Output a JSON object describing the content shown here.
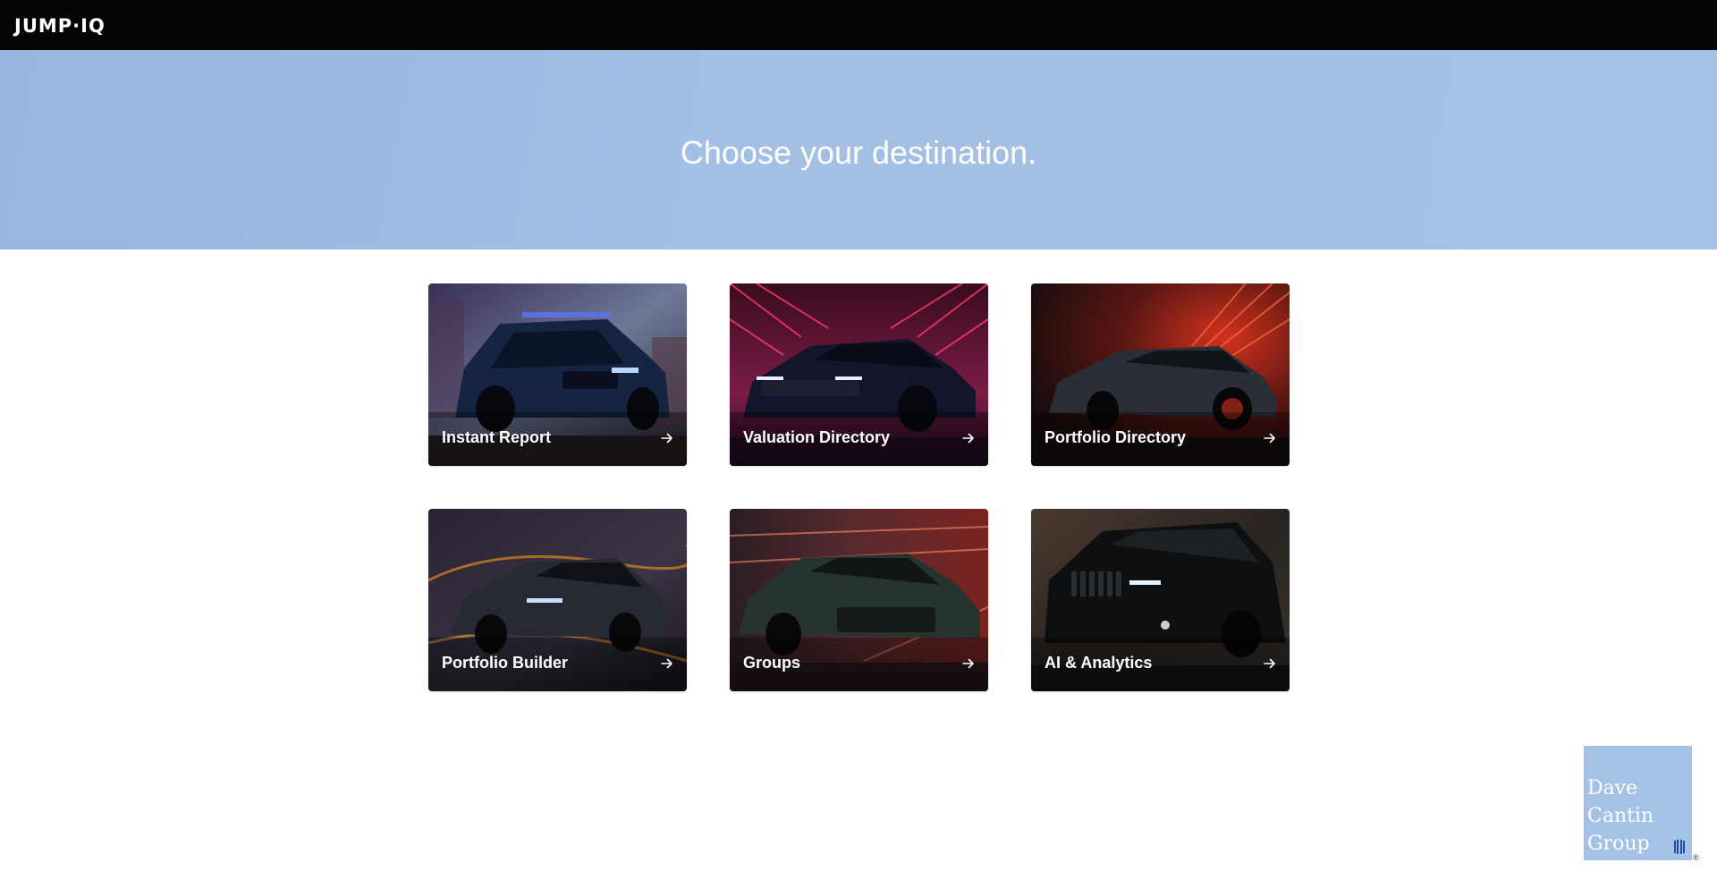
{
  "header": {
    "logo_text": "JUMP·IQ"
  },
  "hero": {
    "title": "Choose your destination."
  },
  "destinations": [
    {
      "label": "Instant Report",
      "icon": "arrow-right-icon",
      "theme": "blue-suv"
    },
    {
      "label": "Valuation Directory",
      "icon": "arrow-right-icon",
      "theme": "magenta-sedan"
    },
    {
      "label": "Portfolio Directory",
      "icon": "arrow-right-icon",
      "theme": "red-sedan"
    },
    {
      "label": "Portfolio Builder",
      "icon": "arrow-right-icon",
      "theme": "dark-sedan-road"
    },
    {
      "label": "Groups",
      "icon": "arrow-right-icon",
      "theme": "green-sedan"
    },
    {
      "label": "AI & Analytics",
      "icon": "arrow-right-icon",
      "theme": "black-suv"
    }
  ],
  "badge": {
    "line1": "Dave",
    "line2": "Cantin",
    "line3": "Group",
    "registered": "®"
  },
  "colors": {
    "topbar": "#050505",
    "hero": "#a3c0e4",
    "badge": "#a3c2e6"
  }
}
